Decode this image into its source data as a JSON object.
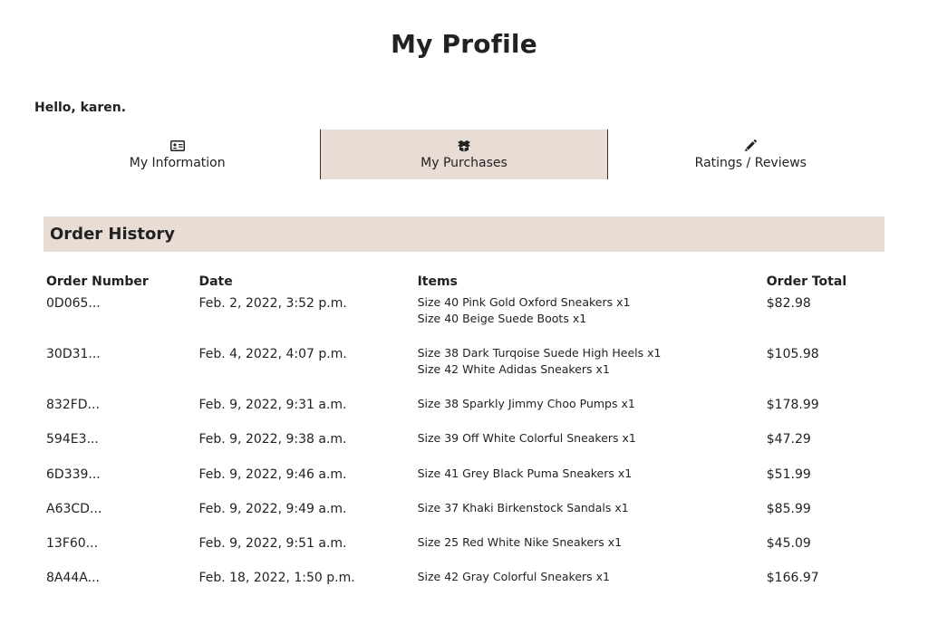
{
  "page": {
    "title": "My Profile",
    "greeting": "Hello, karen."
  },
  "tabs": [
    {
      "label": "My Information",
      "icon": "id-card-icon",
      "active": false
    },
    {
      "label": "My Purchases",
      "icon": "box-icon",
      "active": true
    },
    {
      "label": "Ratings / Reviews",
      "icon": "pencil-icon",
      "active": false
    }
  ],
  "colors": {
    "accent_background": "#e8dcd5",
    "text": "#222222"
  },
  "order_history": {
    "heading": "Order History",
    "columns": {
      "number": "Order Number",
      "date": "Date",
      "items": "Items",
      "total": "Order Total"
    },
    "orders": [
      {
        "number": "0D065...",
        "date": "Feb. 2, 2022, 3:52 p.m.",
        "items": [
          "Size 40 Pink Gold Oxford Sneakers x1",
          "Size 40 Beige Suede Boots x1"
        ],
        "total": "$82.98"
      },
      {
        "number": "30D31...",
        "date": "Feb. 4, 2022, 4:07 p.m.",
        "items": [
          "Size 38 Dark Turqoise Suede High Heels x1",
          "Size 42 White Adidas Sneakers x1"
        ],
        "total": "$105.98"
      },
      {
        "number": "832FD...",
        "date": "Feb. 9, 2022, 9:31 a.m.",
        "items": [
          "Size 38 Sparkly Jimmy Choo Pumps x1"
        ],
        "total": "$178.99"
      },
      {
        "number": "594E3...",
        "date": "Feb. 9, 2022, 9:38 a.m.",
        "items": [
          "Size 39 Off White Colorful Sneakers x1"
        ],
        "total": "$47.29"
      },
      {
        "number": "6D339...",
        "date": "Feb. 9, 2022, 9:46 a.m.",
        "items": [
          "Size 41 Grey Black Puma Sneakers x1"
        ],
        "total": "$51.99"
      },
      {
        "number": "A63CD...",
        "date": "Feb. 9, 2022, 9:49 a.m.",
        "items": [
          "Size 37 Khaki Birkenstock Sandals x1"
        ],
        "total": "$85.99"
      },
      {
        "number": "13F60...",
        "date": "Feb. 9, 2022, 9:51 a.m.",
        "items": [
          "Size 25 Red White Nike Sneakers x1"
        ],
        "total": "$45.09"
      },
      {
        "number": "8A44A...",
        "date": "Feb. 18, 2022, 1:50 p.m.",
        "items": [
          "Size 42 Gray Colorful Sneakers x1"
        ],
        "total": "$166.97"
      }
    ]
  }
}
